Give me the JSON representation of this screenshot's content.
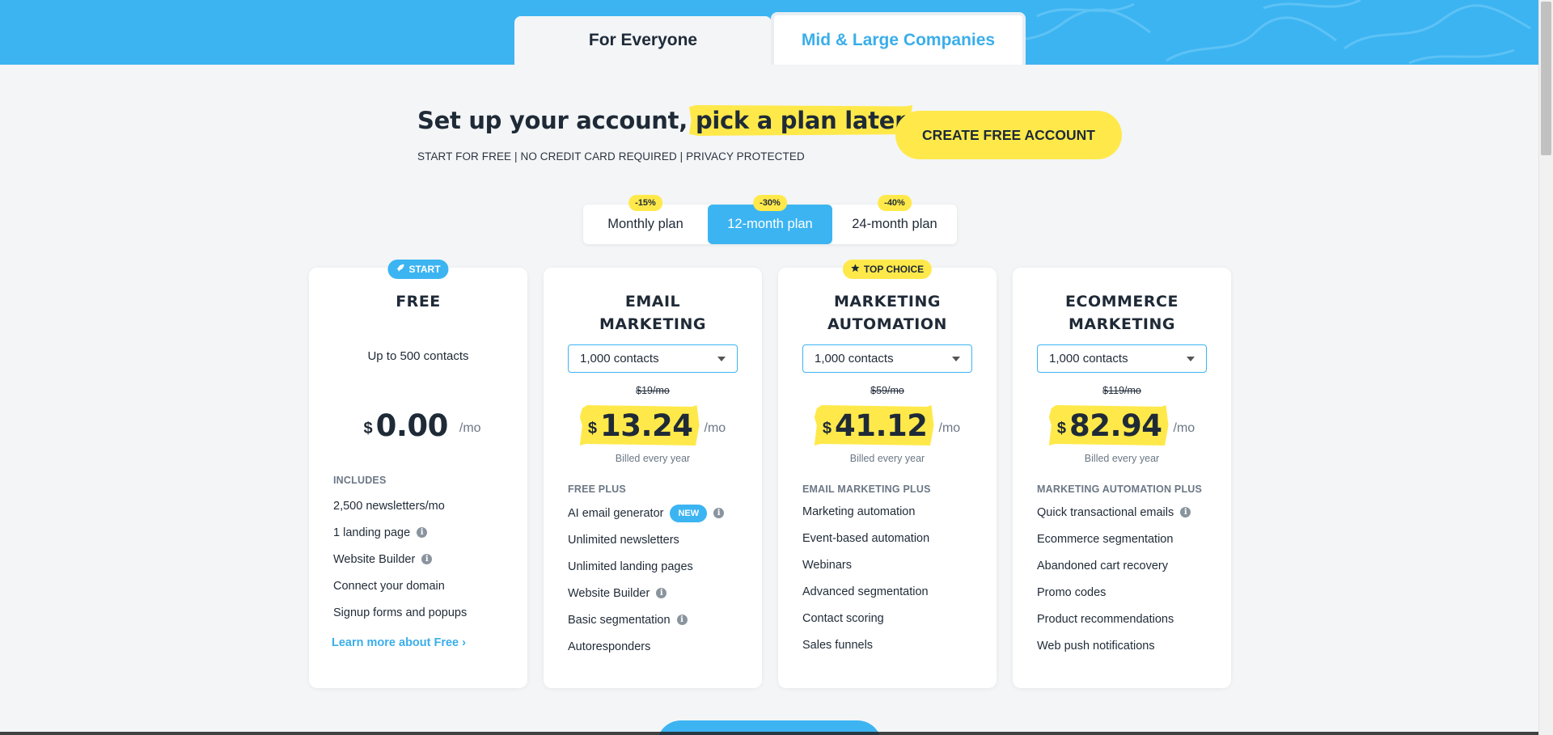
{
  "tabs": {
    "everyone": "For Everyone",
    "companies": "Mid & Large Companies"
  },
  "hero": {
    "headline_prefix": "Set up your account,",
    "headline_highlight": "pick a plan later",
    "subline": "START FOR FREE | NO CREDIT CARD REQUIRED | PRIVACY PROTECTED",
    "cta": "CREATE FREE ACCOUNT"
  },
  "billing": {
    "options": [
      {
        "label": "Monthly plan",
        "discount": "-15%"
      },
      {
        "label": "12-month plan",
        "discount": "-30%"
      },
      {
        "label": "24-month plan",
        "discount": "-40%"
      }
    ],
    "selected": "12-month plan"
  },
  "plans": {
    "free": {
      "badge": "START",
      "title": "FREE",
      "contacts": "Up to 500 contacts",
      "currency": "$",
      "price": "0.00",
      "per": "/mo",
      "features_head": "INCLUDES",
      "features": [
        "2,500 newsletters/mo",
        "1 landing page",
        "Website Builder",
        "Connect your domain",
        "Signup forms and popups"
      ],
      "learn_more": "Learn more about Free ›"
    },
    "email": {
      "title": "EMAIL MARKETING",
      "contacts": "1,000 contacts",
      "old_price": "$19/mo",
      "currency": "$",
      "price": "13.24",
      "per": "/mo",
      "billed": "Billed every year",
      "features_head": "FREE PLUS",
      "features": [
        "AI email generator",
        "Unlimited newsletters",
        "Unlimited landing pages",
        "Website Builder",
        "Basic segmentation",
        "Autoresponders"
      ],
      "new_badge": "NEW"
    },
    "automation": {
      "badge": "TOP CHOICE",
      "title": "MARKETING AUTOMATION",
      "contacts": "1,000 contacts",
      "old_price": "$59/mo",
      "currency": "$",
      "price": "41.12",
      "per": "/mo",
      "billed": "Billed every year",
      "features_head": "EMAIL MARKETING PLUS",
      "features": [
        "Marketing automation",
        "Event-based automation",
        "Webinars",
        "Advanced segmentation",
        "Contact scoring",
        "Sales funnels"
      ]
    },
    "ecommerce": {
      "title": "ECOMMERCE MARKETING",
      "contacts": "1,000 contacts",
      "old_price": "$119/mo",
      "currency": "$",
      "price": "82.94",
      "per": "/mo",
      "billed": "Billed every year",
      "features_head": "MARKETING AUTOMATION PLUS",
      "features": [
        "Quick transactional emails",
        "Ecommerce segmentation",
        "Abandoned cart recovery",
        "Promo codes",
        "Product recommendations",
        "Web push notifications"
      ]
    }
  },
  "colors": {
    "accent_blue": "#3cb4f2",
    "highlight_yellow": "#ffe94a",
    "text_dark": "#1f2a37",
    "muted": "#6b7785"
  },
  "icons": {
    "start_badge": "rocket-icon",
    "top_choice_badge": "star-icon",
    "feature_info": "info-icon",
    "select_caret": "chevron-down-icon"
  }
}
